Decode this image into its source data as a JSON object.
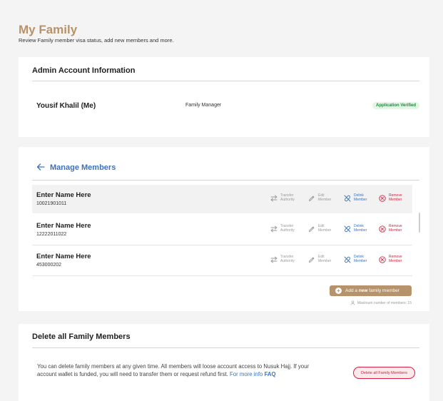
{
  "header": {
    "title": "My Family",
    "subtitle": "Review Family member visa status, add new members and more."
  },
  "admin": {
    "title": "Admin Account Information",
    "name": "Yousif Khalil (Me)",
    "role": "Family Manager",
    "status": "Application Verified"
  },
  "manage": {
    "title": "Manage Members",
    "members": [
      {
        "name": "Enter Name Here",
        "id": "10021901011"
      },
      {
        "name": "Enter Name Here",
        "id": "12222011022"
      },
      {
        "name": "Enter Name Here",
        "id": "453000202"
      }
    ],
    "actions": {
      "transfer_1": "Transfer",
      "transfer_2": "Authority",
      "edit_1": "Edit",
      "edit_2": "Member",
      "delink_1": "Delink",
      "delink_2": "Member",
      "remove_1": "Remove",
      "remove_2": "Member"
    },
    "add_prefix": "Add a",
    "add_bold": "new",
    "add_suffix": "family member",
    "max_note": "Maximum number of members: 15"
  },
  "delete": {
    "title": "Delete all Family Members",
    "text": "You can delete family members at any given time.  All members will loose account access to Nusuk Hajj. If your account wallet is funded, you will need to transfer them or request refund first.",
    "link": "For more info",
    "faq": "FAQ",
    "button": "Delete all Family Members"
  },
  "colors": {
    "brand": "#b6936a",
    "link": "#3a72c2",
    "danger": "#d0223f",
    "success": "#1f8a3a"
  }
}
